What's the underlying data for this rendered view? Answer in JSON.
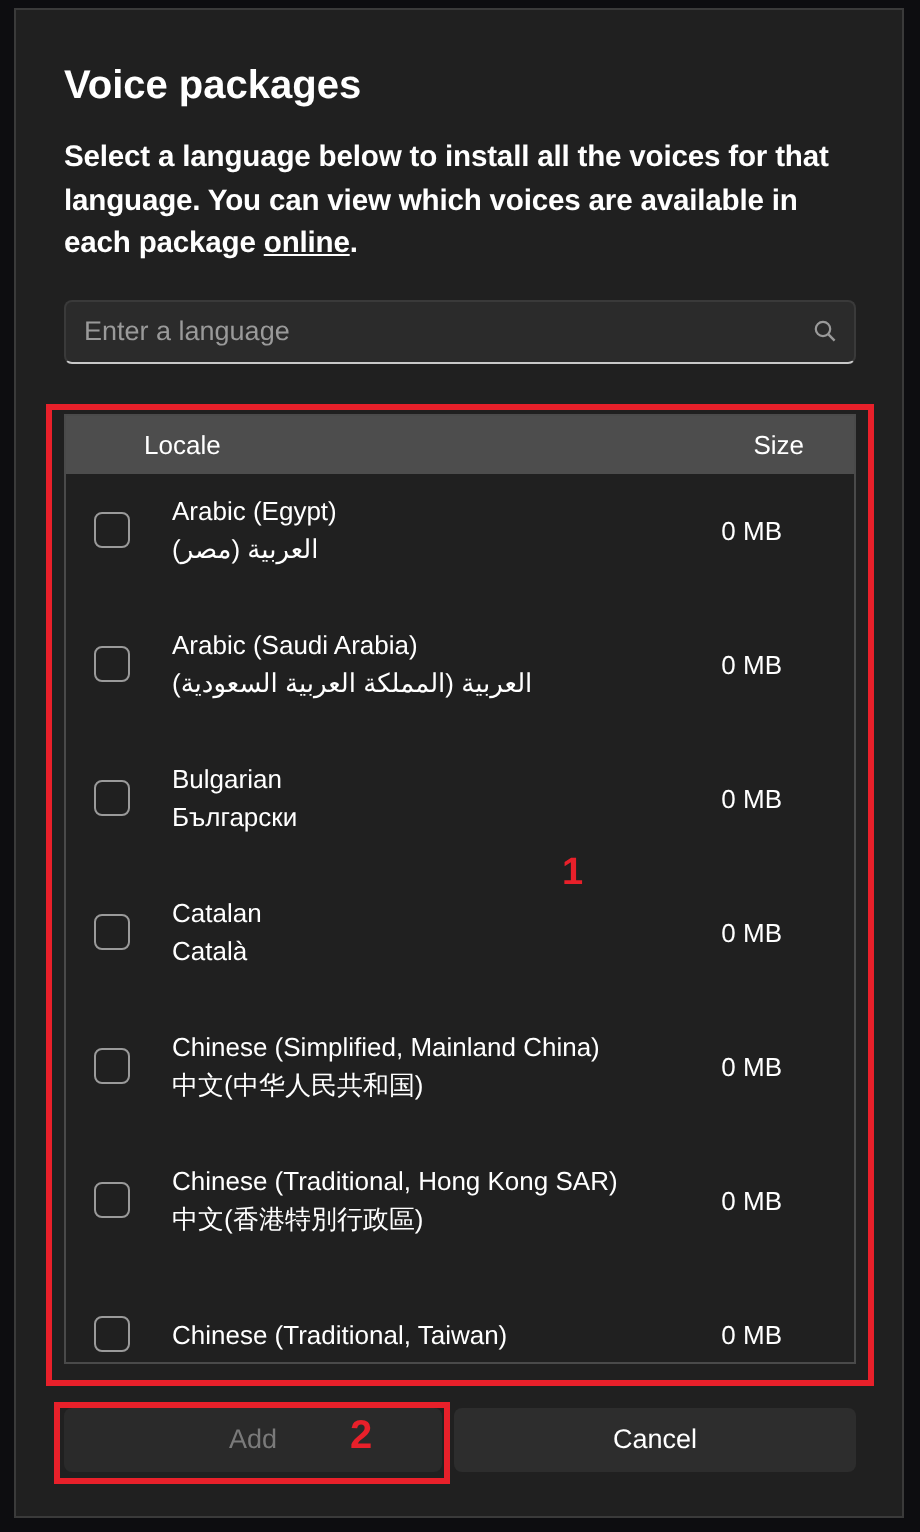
{
  "dialog": {
    "title": "Voice packages",
    "description": "Select a language below to install all the voices for that language. You can view which voices are available in each package ",
    "link": "online",
    "description_end": "."
  },
  "search": {
    "placeholder": "Enter a language"
  },
  "table": {
    "columns": [
      "Locale",
      "Size"
    ],
    "rows": [
      {
        "name": "Arabic (Egypt)",
        "native": "العربية (مصر)",
        "size": "0 MB",
        "checked": false
      },
      {
        "name": "Arabic (Saudi Arabia)",
        "native": "العربية (المملكة العربية السعودية)",
        "size": "0 MB",
        "checked": false
      },
      {
        "name": "Bulgarian",
        "native": "Български",
        "size": "0 MB",
        "checked": false
      },
      {
        "name": "Catalan",
        "native": "Català",
        "size": "0 MB",
        "checked": false
      },
      {
        "name": "Chinese (Simplified, Mainland China)",
        "native": "中文(中华人民共和国)",
        "size": "0 MB",
        "checked": false
      },
      {
        "name": "Chinese (Traditional, Hong Kong SAR)",
        "native": "中文(香港特別行政區)",
        "size": "0 MB",
        "checked": false
      },
      {
        "name": "Chinese (Traditional, Taiwan)",
        "size": "0 MB",
        "checked": false
      }
    ]
  },
  "buttons": [
    {
      "label": "Add",
      "disabled": true
    },
    {
      "label": "Cancel",
      "disabled": false
    }
  ],
  "annotations": [
    {
      "label": "1"
    },
    {
      "label": "2"
    }
  ]
}
